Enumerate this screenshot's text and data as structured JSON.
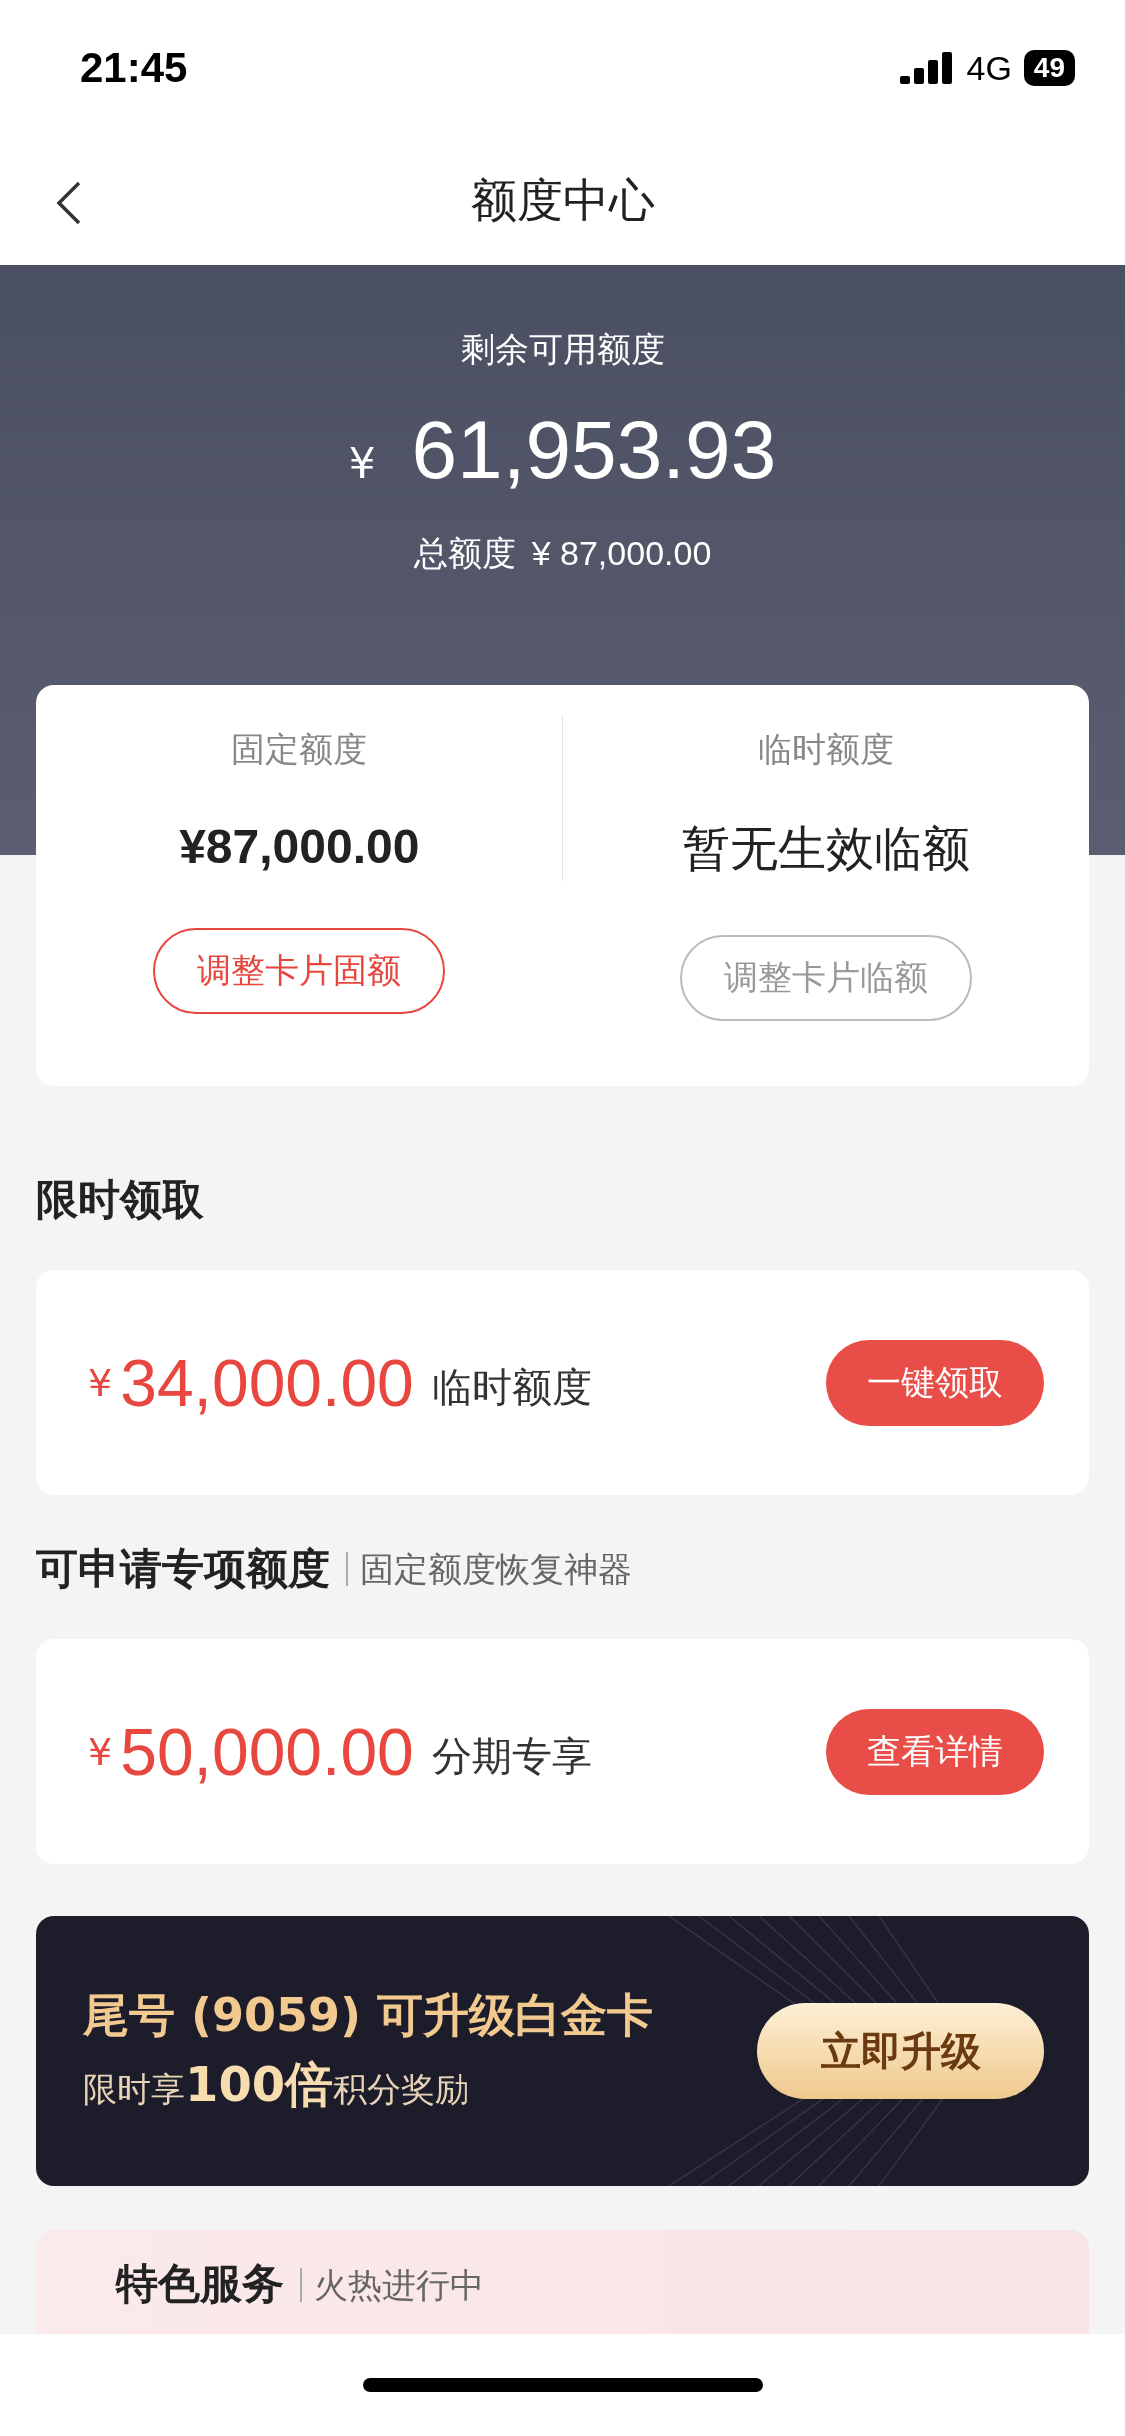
{
  "status_bar": {
    "time": "21:45",
    "network": "4G",
    "battery": "49"
  },
  "nav": {
    "title": "额度中心"
  },
  "summary": {
    "label": "剩余可用额度",
    "currency": "¥",
    "amount": "61,953.93",
    "total_label": "总额度",
    "total_value": "¥ 87,000.00"
  },
  "limits": [
    {
      "label": "固定额度",
      "value": "¥87,000.00",
      "kind": "amount",
      "button": "调整卡片固额",
      "disabled": false
    },
    {
      "label": "临时额度",
      "value": "暂无生效临额",
      "kind": "note",
      "button": "调整卡片临额",
      "disabled": true
    }
  ],
  "offer_sections": [
    {
      "title": "限时领取",
      "offer": {
        "currency": "¥",
        "amount": "34,000.00",
        "label": "临时额度",
        "button": "一键领取"
      }
    },
    {
      "title": "可申请专项额度",
      "subtitle": "固定额度恢复神器",
      "offer": {
        "currency": "¥",
        "amount": "50,000.00",
        "label": "分期专享",
        "button": "查看详情"
      }
    }
  ],
  "upgrade": {
    "title": "尾号 (9059) 可升级白金卡",
    "subtitle": "限时享**100倍**积分奖励",
    "button": "立即升级"
  },
  "feature": {
    "title": "特色服务",
    "subtitle": "火热进行中"
  }
}
